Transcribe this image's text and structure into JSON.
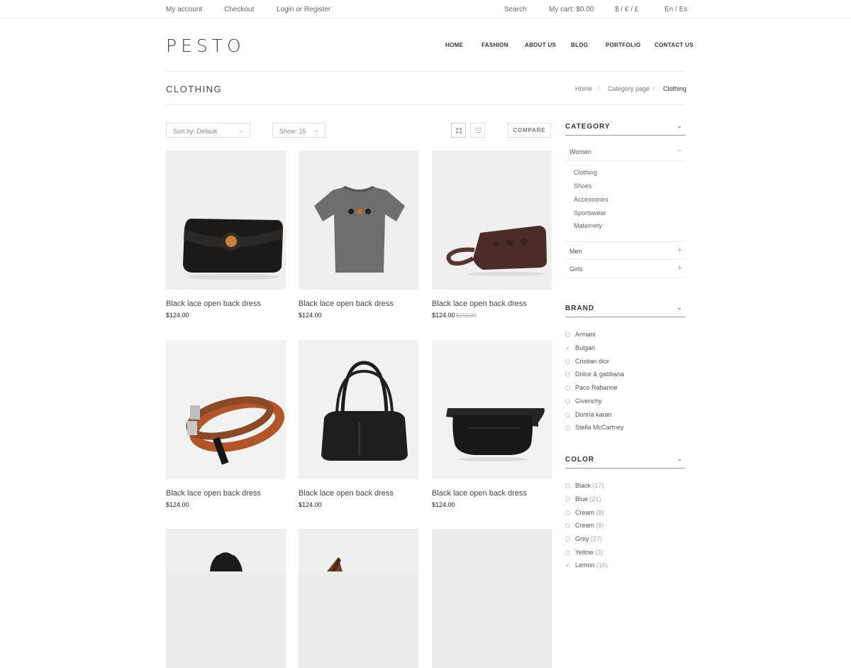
{
  "topbar": {
    "my_account": "My account",
    "checkout": "Checkout",
    "login": "Login or Register",
    "search": "Search",
    "cart": "My cart: $0.00",
    "currency": "$ / € / £",
    "language": "En / Es"
  },
  "logo": "PESTO",
  "nav": [
    "HOME",
    "FASHION",
    "ABOUT US",
    "BLOG",
    "PORTFOLIO",
    "CONTACT US"
  ],
  "page": {
    "title": "CLOTHING",
    "breadcrumb": [
      "Home",
      "Category page",
      "Clothing"
    ],
    "breadcrumb_sep": "/"
  },
  "toolbar": {
    "sort": "Sort by: Default",
    "show": "Show: 15",
    "compare": "COMPARE"
  },
  "products": [
    {
      "name": "Black lace open back dress",
      "price": "$124.00",
      "old_price": "",
      "image": "black-clutch"
    },
    {
      "name": "Black lace open back dress",
      "price": "$124.00",
      "old_price": "",
      "image": "grey-tshirt"
    },
    {
      "name": "Black lace open back dress",
      "price": "$124.00",
      "old_price": "$150.00",
      "image": "leather-luggage-tag"
    },
    {
      "name": "Black lace open back dress",
      "price": "$124.00",
      "old_price": "",
      "image": "leather-belts"
    },
    {
      "name": "Black lace open back dress",
      "price": "$124.00",
      "old_price": "",
      "image": "black-handbag"
    },
    {
      "name": "Black lace open back dress",
      "price": "$124.00",
      "old_price": "",
      "image": "black-waist-bag"
    }
  ],
  "sidebar": {
    "category": {
      "title": "CATEGORY",
      "groups": [
        {
          "label": "Women",
          "toggle": "−",
          "items": [
            "Clothing",
            "Shoes",
            "Accessories",
            "Sportswear",
            "Maternety"
          ]
        },
        {
          "label": "Men",
          "toggle": "+"
        },
        {
          "label": "Girls",
          "toggle": "+"
        }
      ]
    },
    "brand": {
      "title": "BRAND",
      "items": [
        {
          "label": "Armani",
          "checked": false
        },
        {
          "label": "Bulgari",
          "checked": true
        },
        {
          "label": "Cristian dior",
          "checked": false
        },
        {
          "label": "Dolce & gabbana",
          "checked": false
        },
        {
          "label": "Paco Rabanne",
          "checked": false
        },
        {
          "label": "Givenchy",
          "checked": false
        },
        {
          "label": "Donna karan",
          "checked": false
        },
        {
          "label": "Stella McCartney",
          "checked": false
        }
      ]
    },
    "color": {
      "title": "COLOR",
      "items": [
        {
          "label": "Black",
          "count": "(17)",
          "checked": false
        },
        {
          "label": "Blue",
          "count": "(21)",
          "checked": false
        },
        {
          "label": "Cream",
          "count": "(8)",
          "checked": false
        },
        {
          "label": "Cream",
          "count": "(8)",
          "checked": false
        },
        {
          "label": "Grey",
          "count": "(27)",
          "checked": false
        },
        {
          "label": "Yellow",
          "count": "(3)",
          "checked": false
        },
        {
          "label": "Lemon",
          "count": "(16)",
          "checked": true
        }
      ]
    }
  },
  "icons": {
    "chevron": "chevron-down-icon",
    "check": "check-icon",
    "grid_view": "grid-view-icon",
    "list_view": "list-view-icon"
  }
}
